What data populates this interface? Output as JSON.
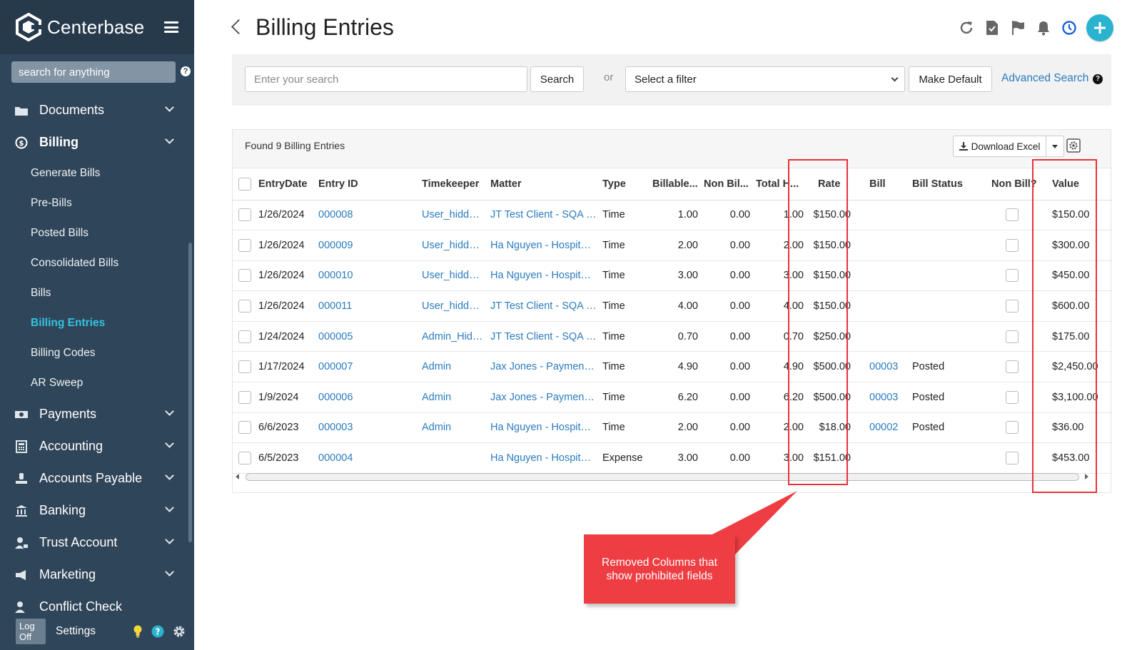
{
  "app": {
    "brand": "Centerbase",
    "search_placeholder": "search for anything",
    "help_glyph": "?"
  },
  "sidebar": {
    "items": [
      {
        "label": "Documents",
        "icon": "folder-icon"
      },
      {
        "label": "Billing",
        "icon": "dollar-circle-icon"
      },
      {
        "label": "Payments",
        "icon": "cash-icon"
      },
      {
        "label": "Accounting",
        "icon": "calculator-icon"
      },
      {
        "label": "Accounts Payable",
        "icon": "hand-coin-icon"
      },
      {
        "label": "Banking",
        "icon": "bank-icon"
      },
      {
        "label": "Trust Account",
        "icon": "user-lock-icon"
      },
      {
        "label": "Marketing",
        "icon": "megaphone-icon"
      },
      {
        "label": "Conflict Check",
        "icon": "user-check-icon"
      }
    ],
    "billing_sub": [
      "Generate Bills",
      "Pre-Bills",
      "Posted Bills",
      "Consolidated Bills",
      "Bills",
      "Billing Entries",
      "Billing Codes",
      "AR Sweep"
    ],
    "active_sub": "Billing Entries",
    "footer": {
      "logoff": "Log Off",
      "settings": "Settings"
    }
  },
  "header": {
    "title": "Billing Entries",
    "accent": "#2ab3ce"
  },
  "search": {
    "placeholder": "Enter your search",
    "button": "Search",
    "or": "or",
    "filter": "Select a filter",
    "make_default": "Make Default",
    "advanced": "Advanced Search"
  },
  "grid": {
    "found": "Found 9 Billing Entries",
    "download": "Download Excel",
    "columns": [
      "EntryDate",
      "Entry ID",
      "Timekeeper",
      "Matter",
      "Type",
      "Billable...",
      "Non Bil...",
      "Total H...",
      "Rate",
      "Bill",
      "Bill Status",
      "Non Bill?",
      "Value"
    ],
    "rows": [
      {
        "date": "1/26/2024",
        "id": "000008",
        "tk": "User_hidden...",
        "matter": "JT Test Client - SQA Bi...",
        "type": "Time",
        "billable": "1.00",
        "nonbill": "0.00",
        "total": "1.00",
        "rate": "$150.00",
        "bill": "",
        "status": "",
        "value": "$150.00"
      },
      {
        "date": "1/26/2024",
        "id": "000009",
        "tk": "User_hidden...",
        "matter": "Ha Nguyen - Hospital ...",
        "type": "Time",
        "billable": "2.00",
        "nonbill": "0.00",
        "total": "2.00",
        "rate": "$150.00",
        "bill": "",
        "status": "",
        "value": "$300.00"
      },
      {
        "date": "1/26/2024",
        "id": "000010",
        "tk": "User_hidden...",
        "matter": "Ha Nguyen - Hospital ...",
        "type": "Time",
        "billable": "3.00",
        "nonbill": "0.00",
        "total": "3.00",
        "rate": "$150.00",
        "bill": "",
        "status": "",
        "value": "$450.00"
      },
      {
        "date": "1/26/2024",
        "id": "000011",
        "tk": "User_hidden...",
        "matter": "JT Test Client - SQA Bi...",
        "type": "Time",
        "billable": "4.00",
        "nonbill": "0.00",
        "total": "4.00",
        "rate": "$150.00",
        "bill": "",
        "status": "",
        "value": "$600.00"
      },
      {
        "date": "1/24/2024",
        "id": "000005",
        "tk": "Admin_Hidd...",
        "matter": "JT Test Client - SQA Bi...",
        "type": "Time",
        "billable": "0.70",
        "nonbill": "0.00",
        "total": "0.70",
        "rate": "$250.00",
        "bill": "",
        "status": "",
        "value": "$175.00"
      },
      {
        "date": "1/17/2024",
        "id": "000007",
        "tk": "Admin",
        "matter": "Jax Jones - Payment ...",
        "type": "Time",
        "billable": "4.90",
        "nonbill": "0.00",
        "total": "4.90",
        "rate": "$500.00",
        "bill": "00003",
        "status": "Posted",
        "value": "$2,450.00"
      },
      {
        "date": "1/9/2024",
        "id": "000006",
        "tk": "Admin",
        "matter": "Jax Jones - Payment ...",
        "type": "Time",
        "billable": "6.20",
        "nonbill": "0.00",
        "total": "6.20",
        "rate": "$500.00",
        "bill": "00003",
        "status": "Posted",
        "value": "$3,100.00"
      },
      {
        "date": "6/6/2023",
        "id": "000003",
        "tk": "Admin",
        "matter": "Ha Nguyen - Hospital ...",
        "type": "Time",
        "billable": "2.00",
        "nonbill": "0.00",
        "total": "2.00",
        "rate": "$18.00",
        "bill": "00002",
        "status": "Posted",
        "value": "$36.00"
      },
      {
        "date": "6/5/2023",
        "id": "000004",
        "tk": "",
        "matter": "Ha Nguyen - Hospital ...",
        "type": "Expense",
        "billable": "3.00",
        "nonbill": "0.00",
        "total": "3.00",
        "rate": "$151.00",
        "bill": "",
        "status": "",
        "value": "$453.00"
      }
    ]
  },
  "annotation": {
    "text": "Removed Columns that show prohibited fields",
    "color": "#ee3d43"
  }
}
